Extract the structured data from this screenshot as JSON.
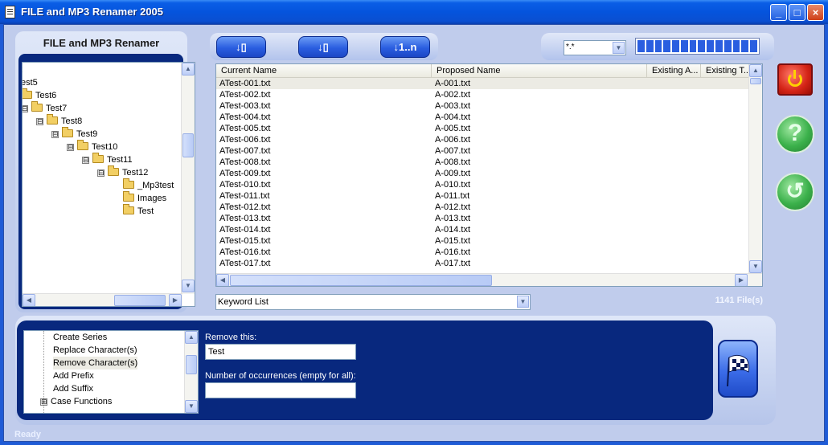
{
  "window": {
    "title": "FILE and MP3 Renamer 2005",
    "minimize_label": "_",
    "maximize_label": "□",
    "close_label": "×"
  },
  "left_panel": {
    "title": "FILE and MP3 Renamer",
    "tree": [
      {
        "label": ":",
        "depth": 0,
        "expander": "",
        "folder": false
      },
      {
        "label": "est5",
        "depth": 0,
        "expander": "",
        "folder": false
      },
      {
        "label": "Test6",
        "depth": 0,
        "expander": "",
        "folder": true
      },
      {
        "label": "Test7",
        "depth": 0,
        "expander": "⊟",
        "folder": true
      },
      {
        "label": "Test8",
        "depth": 1,
        "expander": "⊟",
        "folder": true
      },
      {
        "label": "Test9",
        "depth": 2,
        "expander": "⊟",
        "folder": true
      },
      {
        "label": "Test10",
        "depth": 3,
        "expander": "⊟",
        "folder": true
      },
      {
        "label": "Test11",
        "depth": 4,
        "expander": "⊟",
        "folder": true
      },
      {
        "label": "Test12",
        "depth": 5,
        "expander": "⊟",
        "folder": true
      },
      {
        "label": "_Mp3test",
        "depth": 6,
        "expander": "",
        "folder": true
      },
      {
        "label": "Images",
        "depth": 6,
        "expander": "",
        "folder": true
      },
      {
        "label": "Test",
        "depth": 6,
        "expander": "",
        "folder": true
      }
    ]
  },
  "toolbar": {
    "buttons": [
      {
        "name": "sort-down-files-button",
        "label": "↓▯"
      },
      {
        "name": "sort-down-folders-button",
        "label": "↓▯"
      },
      {
        "name": "number-sequence-button",
        "label": "↓1..n"
      }
    ]
  },
  "filter": {
    "value": "*.*",
    "dropdown_icon": "▼"
  },
  "file_list": {
    "columns": [
      "Current Name",
      "Proposed Name",
      "Existing A...",
      "Existing T..."
    ],
    "rows": [
      {
        "current": "ATest-001.txt",
        "proposed": "A-001.txt"
      },
      {
        "current": "ATest-002.txt",
        "proposed": "A-002.txt"
      },
      {
        "current": "ATest-003.txt",
        "proposed": "A-003.txt"
      },
      {
        "current": "ATest-004.txt",
        "proposed": "A-004.txt"
      },
      {
        "current": "ATest-005.txt",
        "proposed": "A-005.txt"
      },
      {
        "current": "ATest-006.txt",
        "proposed": "A-006.txt"
      },
      {
        "current": "ATest-007.txt",
        "proposed": "A-007.txt"
      },
      {
        "current": "ATest-008.txt",
        "proposed": "A-008.txt"
      },
      {
        "current": "ATest-009.txt",
        "proposed": "A-009.txt"
      },
      {
        "current": "ATest-010.txt",
        "proposed": "A-010.txt"
      },
      {
        "current": "ATest-011.txt",
        "proposed": "A-011.txt"
      },
      {
        "current": "ATest-012.txt",
        "proposed": "A-012.txt"
      },
      {
        "current": "ATest-013.txt",
        "proposed": "A-013.txt"
      },
      {
        "current": "ATest-014.txt",
        "proposed": "A-014.txt"
      },
      {
        "current": "ATest-015.txt",
        "proposed": "A-015.txt"
      },
      {
        "current": "ATest-016.txt",
        "proposed": "A-016.txt"
      },
      {
        "current": "ATest-017.txt",
        "proposed": "A-017.txt"
      }
    ],
    "selected_index": 0
  },
  "keyword_list": {
    "value": "Keyword List",
    "dropdown_icon": "▼"
  },
  "file_count": "1141 File(s)",
  "side_buttons": {
    "help_label": "?",
    "undo_label": "↺"
  },
  "functions": {
    "items": [
      {
        "label": "Create Series",
        "expander": ""
      },
      {
        "label": "Replace Character(s)",
        "expander": ""
      },
      {
        "label": "Remove Character(s)",
        "expander": ""
      },
      {
        "label": "Add Prefix",
        "expander": ""
      },
      {
        "label": "Add Suffix",
        "expander": ""
      },
      {
        "label": "Case Functions",
        "expander": "⊞"
      }
    ],
    "selected_index": 2
  },
  "remove_form": {
    "remove_label": "Remove this:",
    "remove_value": "Test",
    "occurrences_label": "Number of occurrences (empty for all):",
    "occurrences_value": ""
  },
  "status": "Ready",
  "colors": {
    "accent": "#08287e",
    "title_bar": "#0554dd",
    "panel": "#c0ccec",
    "stop": "#d42416",
    "help": "#3bb14b"
  }
}
